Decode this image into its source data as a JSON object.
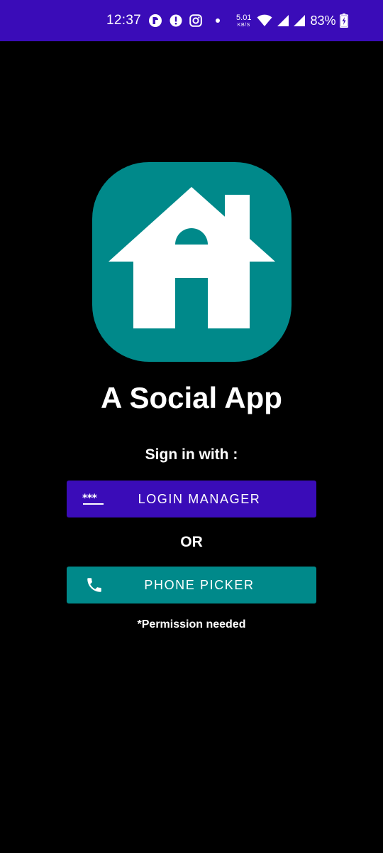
{
  "status_bar": {
    "time": "12:37",
    "net_speed_value": "5.01",
    "net_speed_unit": "KB/S",
    "battery_percent": "83%",
    "icons": [
      "app-notification-icon",
      "alert-icon",
      "instagram-icon",
      "dot-icon",
      "wifi-icon",
      "signal-icon",
      "signal-icon",
      "battery-charging-icon"
    ],
    "background_color": "#3a0cb8"
  },
  "app": {
    "logo_icon": "house-icon",
    "logo_color": "#00898a",
    "title": "A Social App"
  },
  "sign_in": {
    "label": "Sign in with :",
    "login_manager_label": "LOGIN MANAGER",
    "login_manager_icon": "password-icon",
    "login_manager_color": "#3a0cb8",
    "or_label": "OR",
    "phone_picker_label": "PHONE PICKER",
    "phone_picker_icon": "phone-icon",
    "phone_picker_color": "#00898a",
    "permission_note": "*Permission needed"
  }
}
